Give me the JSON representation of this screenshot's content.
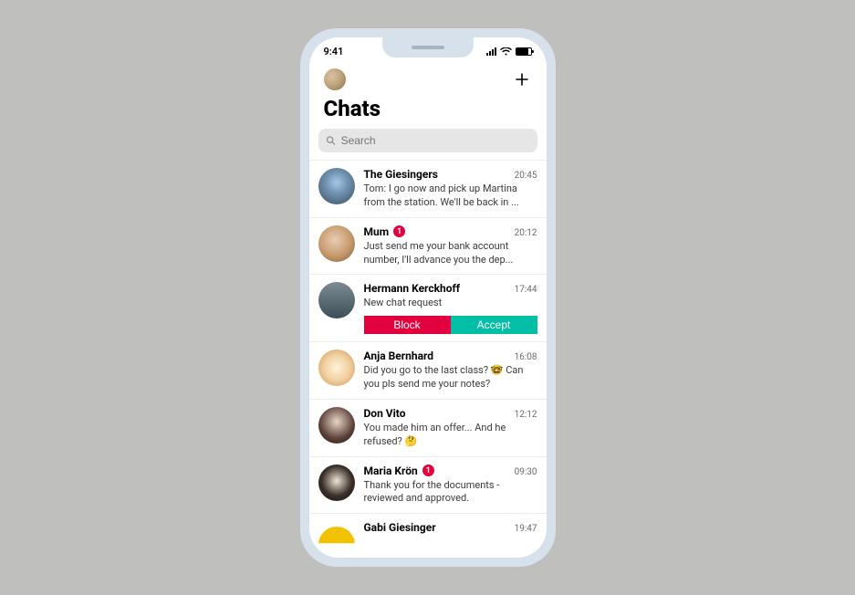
{
  "status": {
    "time": "9:41"
  },
  "header": {
    "title": "Chats"
  },
  "search": {
    "placeholder": "Search"
  },
  "actions": {
    "block": "Block",
    "accept": "Accept"
  },
  "chats": [
    {
      "name": "The Giesingers",
      "time": "20:45",
      "preview": "Tom: I go now and pick up Martina from the station. We'll be back in ...",
      "badge": null,
      "request": false,
      "avatar": "av0"
    },
    {
      "name": "Mum",
      "time": "20:12",
      "preview": "Just send me your bank account number, I'll advance you the dep...",
      "badge": "1",
      "request": false,
      "avatar": "av1"
    },
    {
      "name": "Hermann Kerckhoff",
      "time": "17:44",
      "preview": "New chat request",
      "badge": null,
      "request": true,
      "avatar": "av2"
    },
    {
      "name": "Anja Bernhard",
      "time": "16:08",
      "preview": "Did you go to the last class? 🤓 Can you pls send me your notes?",
      "badge": null,
      "request": false,
      "avatar": "av3"
    },
    {
      "name": "Don Vito",
      "time": "12:12",
      "preview": "You made him an offer... And he refused? 🤔",
      "badge": null,
      "request": false,
      "avatar": "av4"
    },
    {
      "name": "Maria Krön",
      "time": "09:30",
      "preview": "Thank you for the documents - reviewed and approved.",
      "badge": "1",
      "request": false,
      "avatar": "av5"
    },
    {
      "name": "Gabi Giesinger",
      "time": "19:47",
      "preview": "",
      "badge": null,
      "request": false,
      "avatar": "av6"
    }
  ]
}
